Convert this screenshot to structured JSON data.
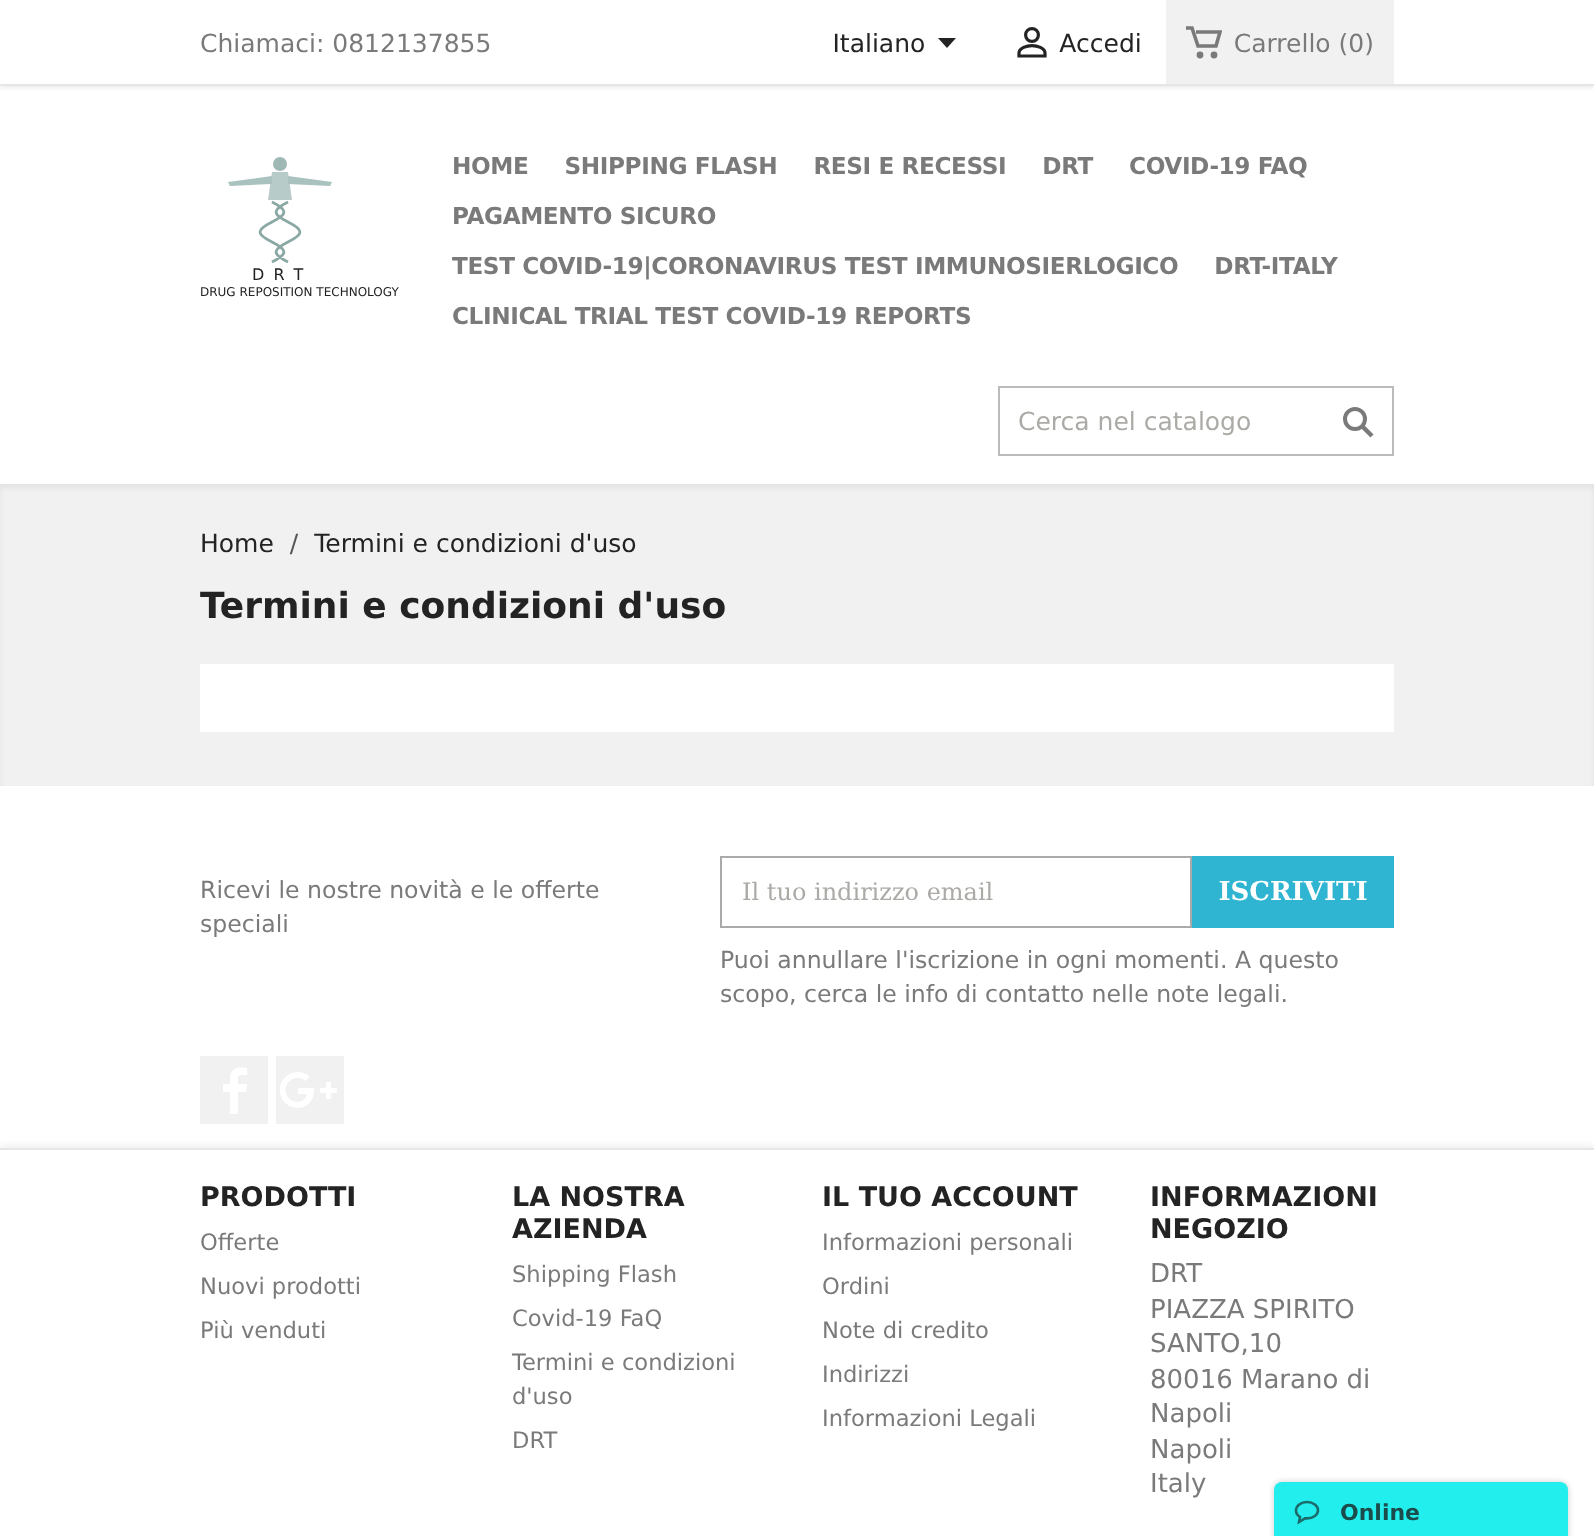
{
  "top_bar": {
    "contact": "Chiamaci: 0812137855",
    "language": "Italiano",
    "login": "Accedi",
    "cart": "Carrello (0)"
  },
  "logo": {
    "letters": "D R T",
    "tagline": "DRUG REPOSITION TECHNOLOGY"
  },
  "menu": [
    {
      "label": "HOME"
    },
    {
      "label": "SHIPPING FLASH"
    },
    {
      "label": "RESI E RECESSI"
    },
    {
      "label": "DRT"
    },
    {
      "label": "COVID-19 FAQ"
    },
    {
      "label": "PAGAMENTO SICURO"
    },
    {
      "label": "TEST COVID-19|CORONAVIRUS TEST IMMUNOSIERLOGICO"
    },
    {
      "label": "DRT-ITALY"
    },
    {
      "label": "CLINICAL TRIAL TEST COVID-19 REPORTS"
    }
  ],
  "search": {
    "placeholder": "Cerca nel catalogo"
  },
  "breadcrumb": {
    "separator": "/",
    "items": [
      "Home",
      "Termini e condizioni d'uso"
    ]
  },
  "page_title": "Termini e condizioni d'uso",
  "newsletter": {
    "text": "Ricevi le nostre novità e le offerte speciali",
    "placeholder": "Il tuo indirizzo email",
    "button": "ISCRIVITI",
    "note": "Puoi annullare l'iscrizione in ogni momenti. A questo scopo, cerca le info di contatto nelle note legali."
  },
  "social": [
    {
      "kind": "facebook"
    },
    {
      "kind": "googleplus"
    }
  ],
  "footer": [
    {
      "title": "PRODOTTI",
      "links": [
        "Offerte",
        "Nuovi prodotti",
        "Più venduti"
      ]
    },
    {
      "title": "LA NOSTRA AZIENDA",
      "links": [
        "Shipping Flash",
        "Covid-19 FaQ",
        "Termini e condizioni d'uso",
        "DRT"
      ]
    },
    {
      "title": "IL TUO ACCOUNT",
      "links": [
        "Informazioni personali",
        "Ordini",
        "Note di credito",
        "Indirizzi",
        "Informazioni Legali"
      ]
    },
    {
      "title": "INFORMAZIONI NEGOZIO",
      "address": [
        "DRT",
        "PIAZZA SPIRITO SANTO,10",
        "80016 Marano di Napoli",
        "Napoli",
        "Italy"
      ]
    }
  ],
  "chat": {
    "label": "Online"
  }
}
